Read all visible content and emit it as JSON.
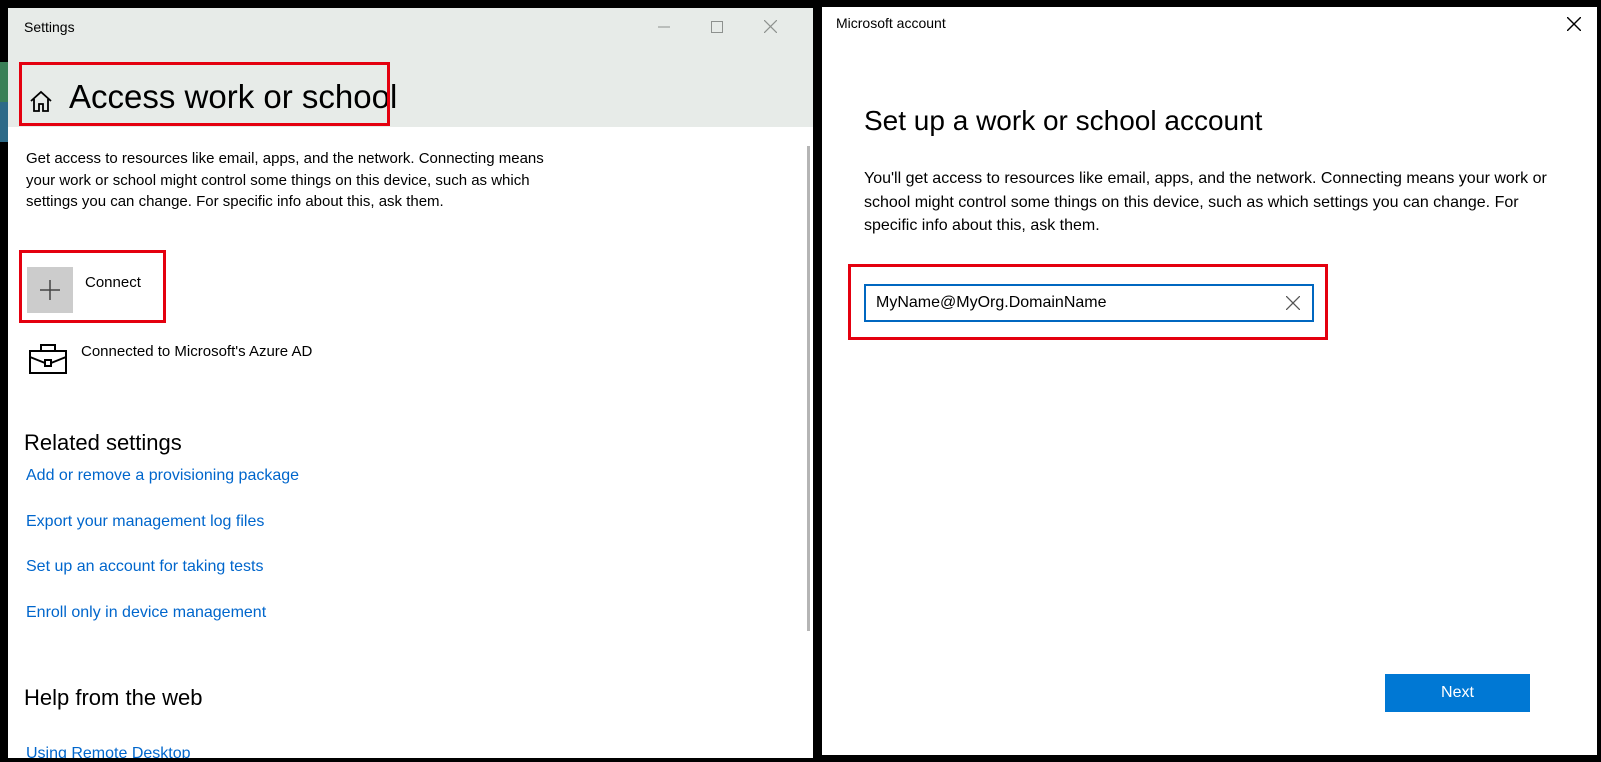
{
  "settings_window": {
    "title": "Settings",
    "page_title": "Access work or school",
    "description": "Get access to resources like email, apps, and the network. Connecting means your work or school might control some things on this device, such as which settings you can change. For specific info about this, ask them.",
    "connect_label": "Connect",
    "azure_label": "Connected to Microsoft's Azure AD",
    "related_heading": "Related settings",
    "related_links": [
      "Add or remove a provisioning package",
      "Export your management log files",
      "Set up an account for taking tests",
      "Enroll only in device management"
    ],
    "help_heading": "Help from the web",
    "help_links": [
      "Using Remote Desktop"
    ]
  },
  "msa_dialog": {
    "title": "Microsoft account",
    "heading": "Set up a work or school account",
    "description": "You'll get access to resources like email, apps, and the network. Connecting means your work or school might control some things on this device, such as which settings you can change. For specific info about this, ask them.",
    "email_value": "MyName@MyOrg.DomainName",
    "next_label": "Next"
  },
  "colors": {
    "accent": "#0078d4",
    "link": "#0066cc",
    "highlight": "#e4000f",
    "header_bg": "#e7ebe8"
  },
  "icons": [
    "home-icon",
    "plus-icon",
    "briefcase-icon",
    "clear-icon",
    "close-icon",
    "minimize-icon",
    "maximize-icon"
  ]
}
